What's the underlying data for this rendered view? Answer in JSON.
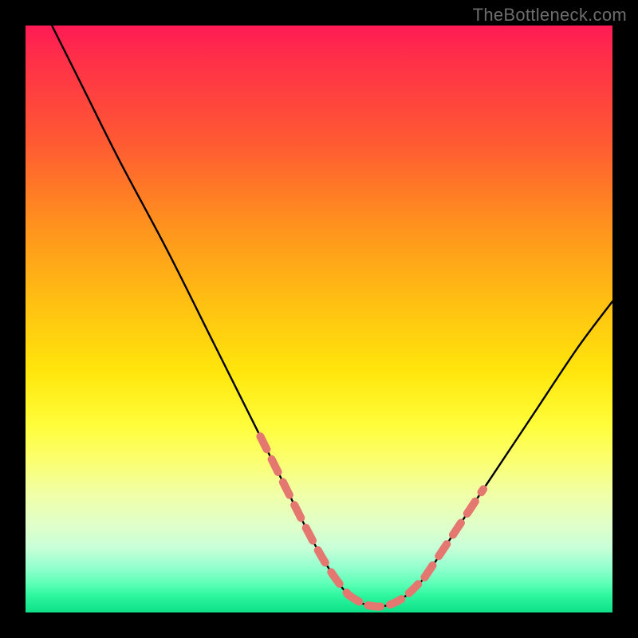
{
  "watermark": "TheBottleneck.com",
  "colors": {
    "page_bg": "#000000",
    "curve_stroke": "#000000",
    "dash_stroke": "#e4776f",
    "gradient_top": "#ff1a55",
    "gradient_bottom": "#10df88"
  },
  "chart_data": {
    "type": "line",
    "title": "",
    "xlabel": "",
    "ylabel": "",
    "xlim": [
      0,
      100
    ],
    "ylim": [
      0,
      100
    ],
    "grid": false,
    "series": [
      {
        "name": "bottleneck-curve",
        "x": [
          4.5,
          10,
          16,
          24,
          32,
          40,
          48,
          52,
          55,
          57.5,
          60,
          62.5,
          65,
          68,
          72,
          78,
          86,
          94,
          100
        ],
        "values": [
          100,
          89,
          77,
          62,
          46,
          30,
          14,
          7,
          3,
          1.5,
          1,
          1.5,
          3,
          6,
          12,
          21,
          33,
          45,
          53
        ]
      }
    ],
    "annotations": [
      {
        "name": "dashed-left-segment",
        "x": [
          40,
          48,
          52,
          55
        ],
        "values": [
          30,
          14,
          7,
          3
        ]
      },
      {
        "name": "dashed-valley-segment",
        "x": [
          55,
          57.5,
          60,
          62.5,
          65,
          68
        ],
        "values": [
          3,
          1.5,
          1,
          1.5,
          3,
          6
        ]
      },
      {
        "name": "dashed-right-segment",
        "x": [
          68,
          72,
          78
        ],
        "values": [
          6,
          12,
          21
        ]
      }
    ]
  }
}
